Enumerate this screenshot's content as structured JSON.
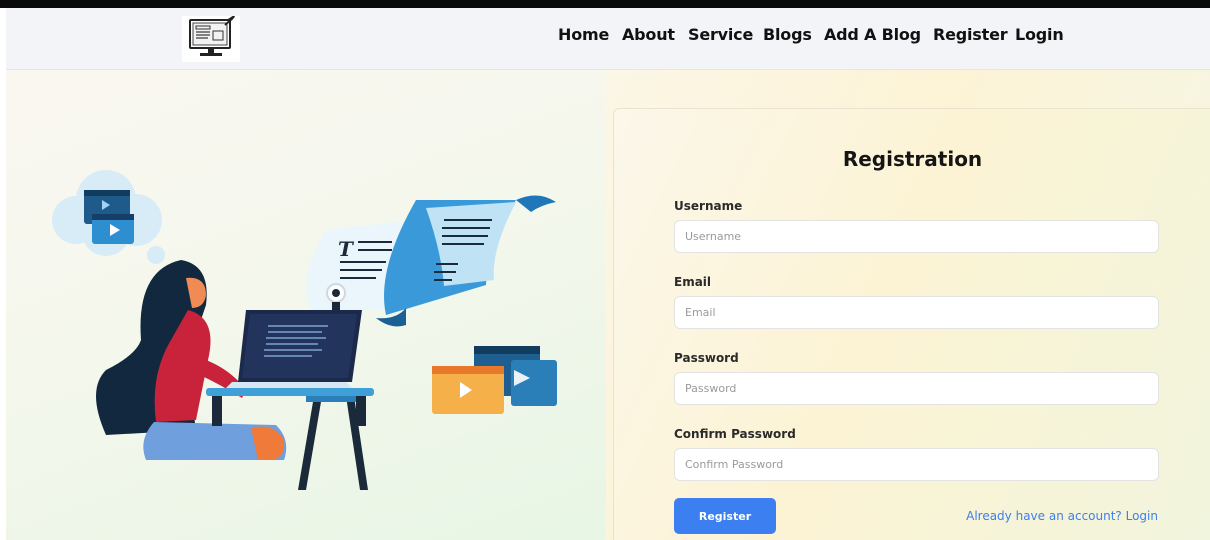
{
  "nav": {
    "logo_icon": "monitor-document-icon",
    "links": [
      "Home",
      "About",
      "Service",
      "Blogs",
      "Add A Blog",
      "Register",
      "Login"
    ]
  },
  "hero": {
    "illustration": "woman-blogging-at-desk-illustration"
  },
  "form": {
    "title": "Registration",
    "username_label": "Username",
    "username_placeholder": "Username",
    "username_value": "",
    "email_label": "Email",
    "email_placeholder": "Email",
    "email_value": "",
    "password_label": "Password",
    "password_placeholder": "Password",
    "password_value": "",
    "confirm_label": "Confirm Password",
    "confirm_placeholder": "Confirm Password",
    "confirm_value": "",
    "register_button": "Register",
    "login_link": "Already have an account? Login"
  },
  "colors": {
    "accent": "#3b7ff0",
    "nav_bg": "#f3f4f8",
    "card_bg": "#fcf3d4"
  }
}
